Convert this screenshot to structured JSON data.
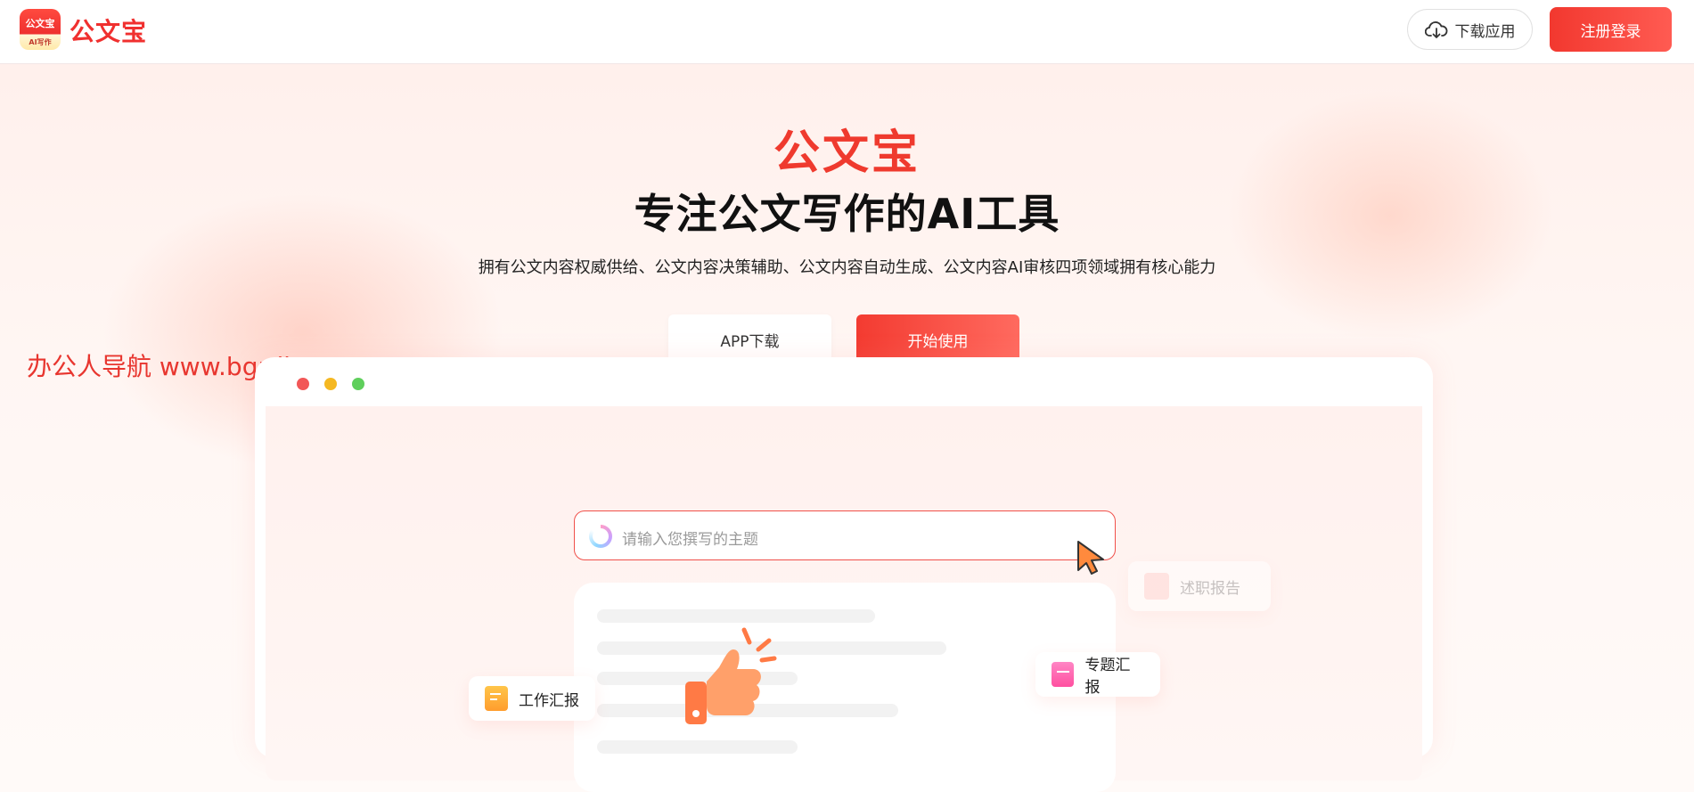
{
  "header": {
    "logo_top": "公文宝",
    "logo_bottom": "AI写作",
    "brand": "公文宝",
    "download_label": "下载应用",
    "register_label": "注册登录"
  },
  "hero": {
    "brand": "公文宝",
    "title": "专注公文写作的AI工具",
    "subtitle": "拥有公文内容权威供给、公文内容决策辅助、公文内容自动生成、公文内容AI审核四项领域拥有核心能力",
    "app_download_label": "APP下载",
    "start_label": "开始使用"
  },
  "watermark": "办公人导航 www.bgrdh.com",
  "mockup": {
    "search_placeholder": "请输入您撰写的主题",
    "tags": [
      {
        "label": "工作汇报",
        "icon": "orange-doc-icon"
      },
      {
        "label": "专题汇报",
        "icon": "pink-doc-icon"
      },
      {
        "label": "述职报告",
        "icon": "grey-doc-icon"
      }
    ]
  },
  "colors": {
    "accent": "#f0302f",
    "background": "#fff4f1"
  }
}
